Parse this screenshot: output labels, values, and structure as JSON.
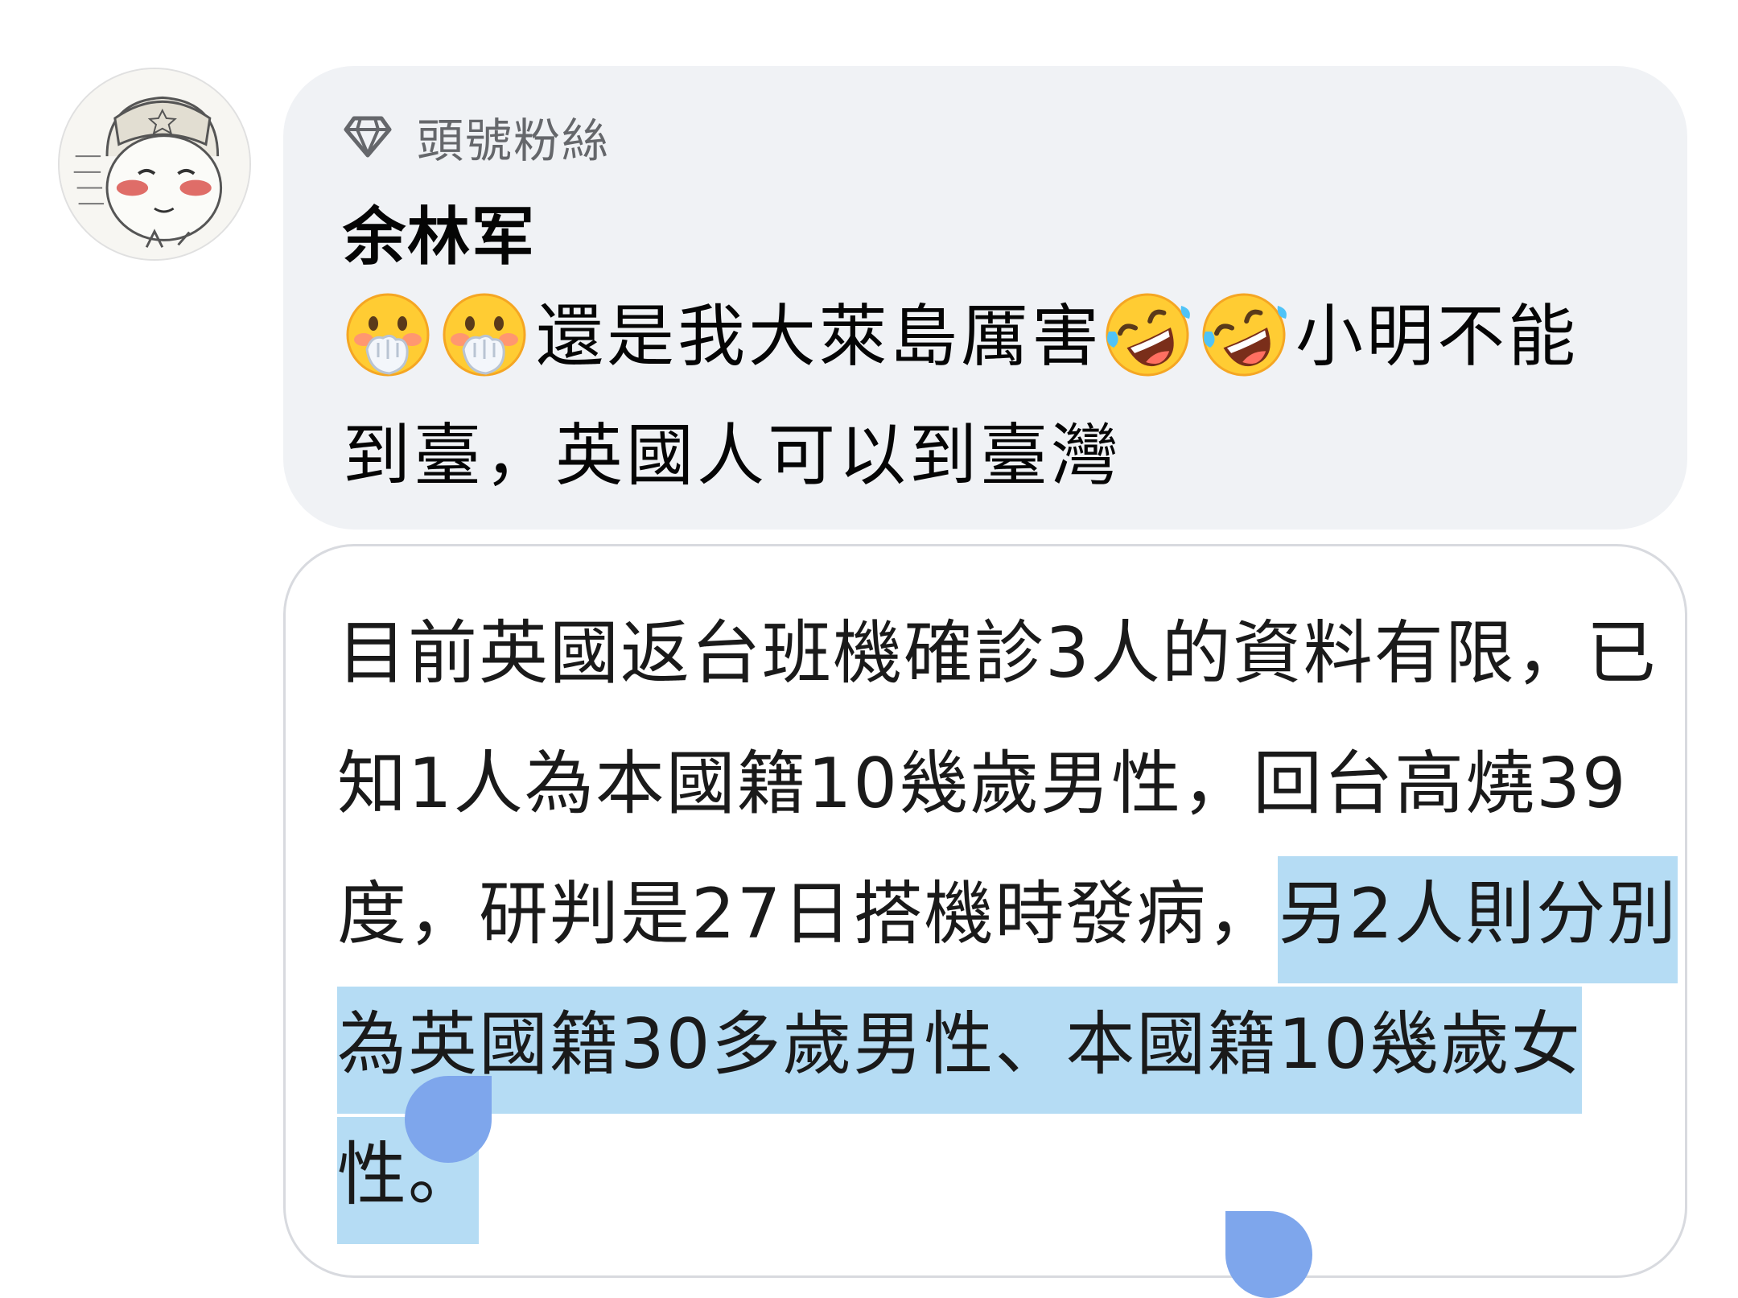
{
  "comment": {
    "badge_label": "頭號粉絲",
    "badge_icon": "diamond-icon",
    "author": "余林军",
    "emojis": [
      "face-with-hand-over-mouth",
      "rolling-on-floor-laughing"
    ],
    "text_part1": "還是我大萊島厲害",
    "text_part2": "小明不能到臺，英國人可以到臺灣"
  },
  "attachment": {
    "text_plain": "目前英國返台班機確診3人的資料有限，已知1人為本國籍10幾歲男性，回台高燒39度，研判是27日搭機時發病，",
    "text_selected": "另2人則分別為英國籍30多歲男性、本國籍10幾歲女性。",
    "highlight_color": "#b5dcf4",
    "handle_color": "#7ea6ec"
  }
}
